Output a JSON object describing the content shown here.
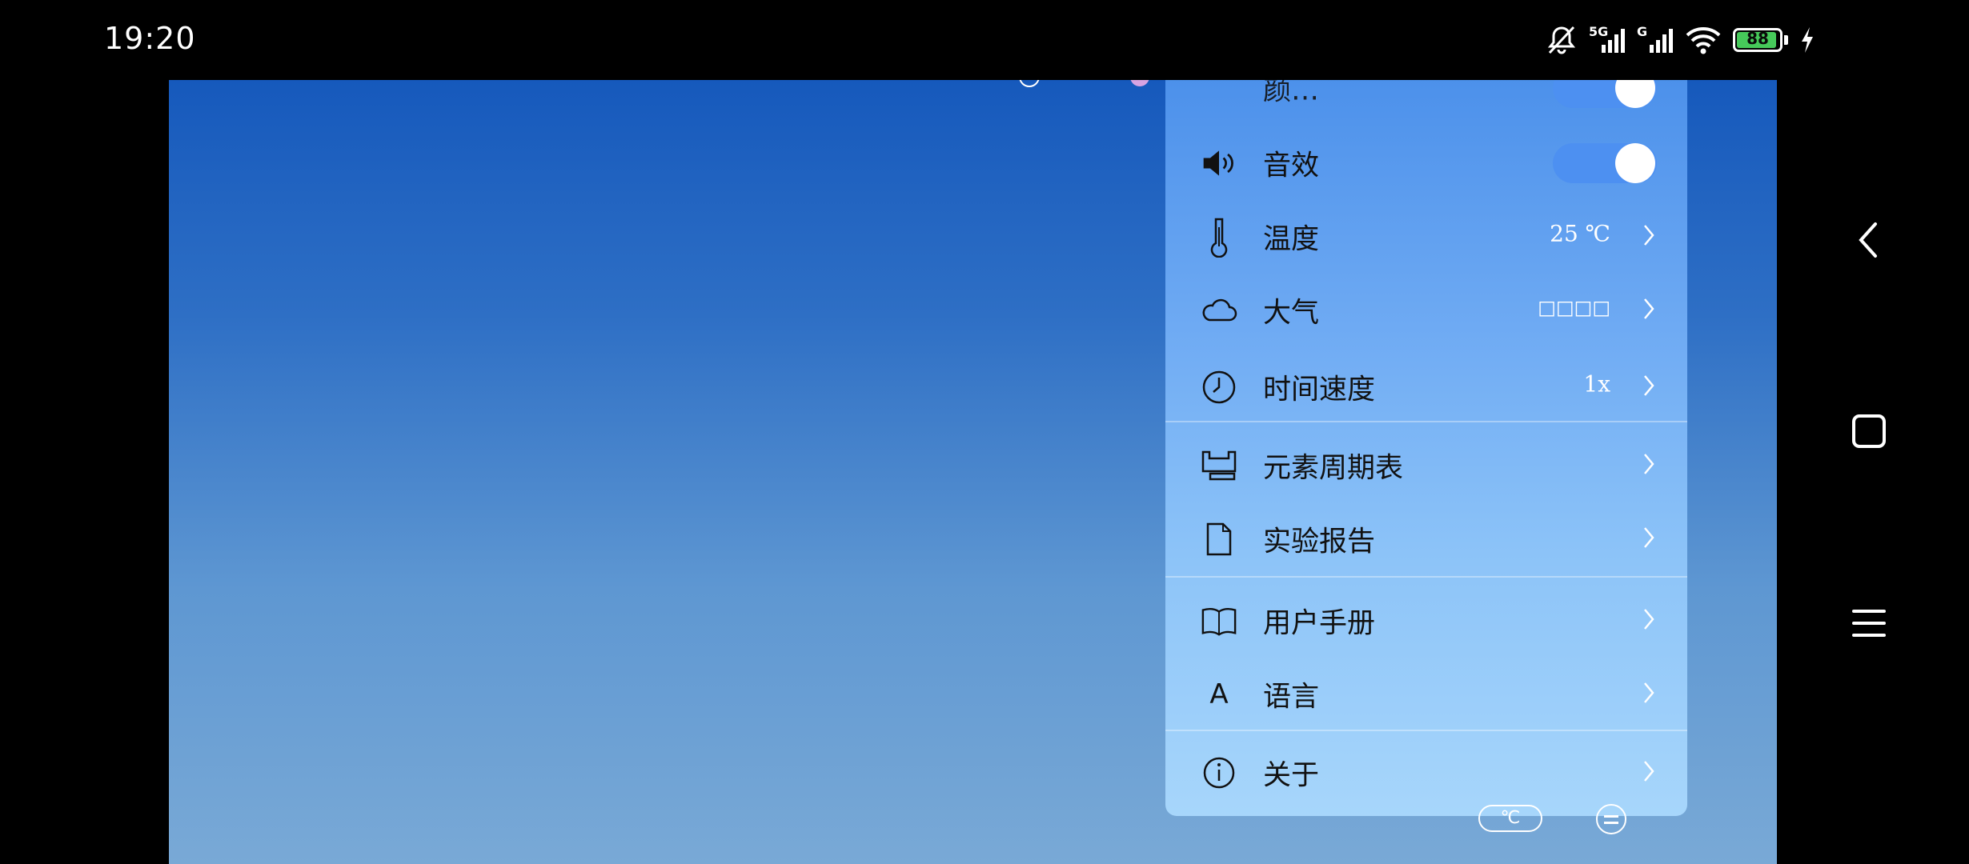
{
  "status_bar": {
    "time": "19:20",
    "network_1": "5G",
    "network_2": "G",
    "battery": "88",
    "icons": [
      "mute-bell-icon",
      "signal-icon",
      "signal-icon",
      "wifi-icon",
      "battery-icon",
      "charging-icon"
    ]
  },
  "menu": {
    "partial_top_label": "颜…",
    "items": [
      {
        "label": "音效",
        "icon": "speaker-icon",
        "control": "toggle",
        "on": true
      },
      {
        "label": "温度",
        "icon": "thermometer-icon",
        "value": "25 ℃"
      },
      {
        "label": "大气",
        "icon": "cloud-icon",
        "value": "□□□□"
      },
      {
        "label": "时间速度",
        "icon": "clock-icon",
        "value": "1x"
      },
      {
        "label": "元素周期表",
        "icon": "periodic-table-icon"
      },
      {
        "label": "实验报告",
        "icon": "document-icon"
      },
      {
        "label": "用户手册",
        "icon": "book-icon"
      },
      {
        "label": "语言",
        "icon": "language-icon",
        "icon_text": "A"
      },
      {
        "label": "关于",
        "icon": "info-icon"
      }
    ]
  },
  "bottom": {
    "unit_button": "℃"
  },
  "navigation": {
    "icons": [
      "back-icon",
      "home-icon",
      "recents-icon"
    ]
  },
  "colors": {
    "panel_top": "#4a8fea",
    "panel_bottom": "#a7d6fb",
    "toggle_on": "#4d90f1",
    "battery_fill": "#46c95a"
  }
}
